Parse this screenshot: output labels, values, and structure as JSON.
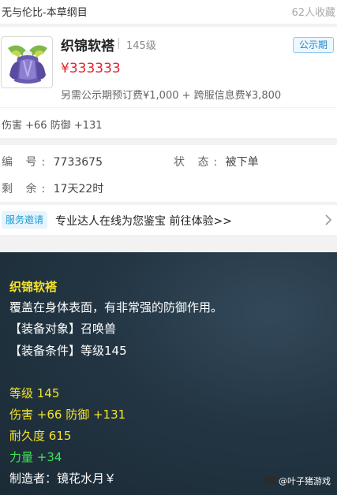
{
  "header": {
    "title": "无与伦比-本草纲目",
    "favorites": "62人收藏"
  },
  "item": {
    "name": "织锦软褡",
    "level": "145级",
    "status_badge": "公示期",
    "price": "¥333333",
    "fee_note": "另需公示期预订费¥1,000 + 跨服信息费¥3,800",
    "attributes": "伤害 +66 防御 +131",
    "icon": "robe-icon"
  },
  "info": {
    "id_label": "编  号:",
    "id_value": "7733675",
    "state_label": "状  态:",
    "state_value": "被下单",
    "remain_label": "剩  余:",
    "remain_value": "17天22时"
  },
  "service": {
    "tag": "服务邀请",
    "text": "专业达人在线为您鉴宝 前往体验>>"
  },
  "tooltip": {
    "title": "织锦软褡",
    "desc": "覆盖在身体表面，有非常强的防御作用。",
    "target": "【装备对象】召唤兽",
    "condition": "【装备条件】等级145",
    "level": "等级 145",
    "stats": "伤害 +66 防御 +131",
    "durability": "耐久度 615",
    "strength": "力量 +34",
    "maker": "制造者：镜花水月￥"
  },
  "watermark": "@叶子猪游戏",
  "colors": {
    "price": "#e0252e",
    "accent": "#1e88c8",
    "tooltip_yellow": "#f3e32b",
    "tooltip_green": "#3ce655"
  }
}
